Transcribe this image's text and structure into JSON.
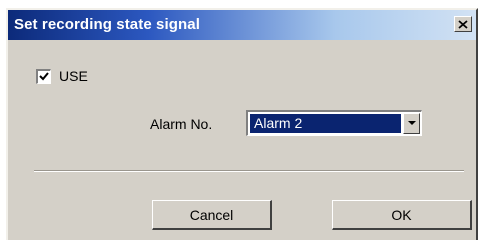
{
  "window": {
    "title": "Set recording state signal"
  },
  "use_checkbox": {
    "label": "USE",
    "checked": true
  },
  "alarm": {
    "label": "Alarm No.",
    "selected": "Alarm 2"
  },
  "buttons": {
    "cancel_label": "Cancel",
    "ok_label": "OK"
  },
  "colors": {
    "title_bar_start": "#0c2a7a",
    "dialog_face": "#d4d0c8",
    "selection": "#0a2470"
  },
  "icons": {
    "close": "close-icon",
    "check": "checkmark-icon",
    "dropdown": "chevron-down-icon"
  }
}
